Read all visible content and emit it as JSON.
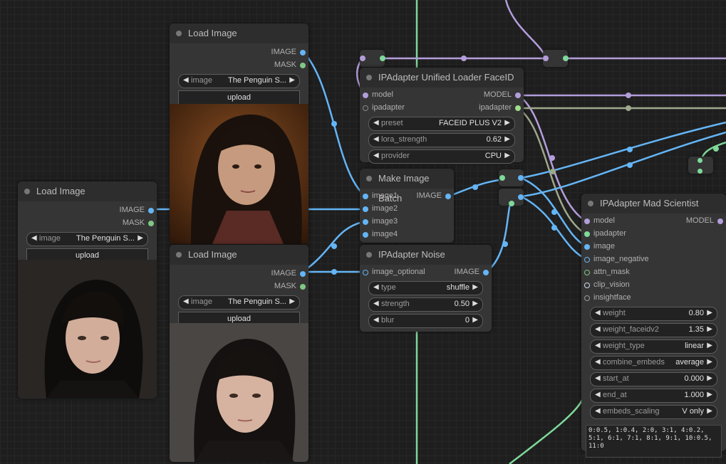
{
  "colors": {
    "image": "#64b5f6",
    "mask": "#81c784",
    "model": "#b39ddb",
    "ipadapter": "#9ea88c",
    "green_wire": "#7fd89a",
    "socket_grey": "#888888"
  },
  "nodes": {
    "load_image_1": {
      "title": "Load Image",
      "out_image": "IMAGE",
      "out_mask": "MASK",
      "widget_label": "image",
      "widget_value": "The Penguin S...",
      "upload_label": "upload"
    },
    "load_image_2": {
      "title": "Load Image",
      "out_image": "IMAGE",
      "out_mask": "MASK",
      "widget_label": "image",
      "widget_value": "The Penguin S...",
      "upload_label": "upload"
    },
    "load_image_3": {
      "title": "Load Image",
      "out_image": "IMAGE",
      "out_mask": "MASK",
      "widget_label": "image",
      "widget_value": "The Penguin S...",
      "upload_label": "upload"
    },
    "unified_loader": {
      "title": "IPAdapter Unified Loader FaceID",
      "in_model": "model",
      "in_ipadapter": "ipadapter",
      "out_model": "MODEL",
      "out_ipadapter": "ipadapter",
      "widgets": [
        {
          "label": "preset",
          "value": "FACEID PLUS V2"
        },
        {
          "label": "lora_strength",
          "value": "0.62"
        },
        {
          "label": "provider",
          "value": "CPU"
        }
      ]
    },
    "make_batch": {
      "title": "Make Image Batch",
      "inputs": [
        "image1",
        "image2",
        "image3",
        "image4"
      ],
      "out_image": "IMAGE"
    },
    "noise": {
      "title": "IPAdapter Noise",
      "in_image_optional": "image_optional",
      "out_image": "IMAGE",
      "widgets": [
        {
          "label": "type",
          "value": "shuffle"
        },
        {
          "label": "strength",
          "value": "0.50"
        },
        {
          "label": "blur",
          "value": "0"
        }
      ]
    },
    "mad_scientist": {
      "title": "IPAdapter Mad Scientist",
      "out_model": "MODEL",
      "inputs": [
        "model",
        "ipadapter",
        "image",
        "image_negative",
        "attn_mask",
        "clip_vision",
        "insightface"
      ],
      "widgets": [
        {
          "label": "weight",
          "value": "0.80"
        },
        {
          "label": "weight_faceidv2",
          "value": "1.35"
        },
        {
          "label": "weight_type",
          "value": "linear"
        },
        {
          "label": "combine_embeds",
          "value": "average"
        },
        {
          "label": "start_at",
          "value": "0.000"
        },
        {
          "label": "end_at",
          "value": "1.000"
        },
        {
          "label": "embeds_scaling",
          "value": "V only"
        }
      ],
      "layer_weights": "0:0.5, 1:0.4, 2:0, 3:1, 4:0.2,\n5:1, 6:1, 7:1, 8:1, 9:1, 10:0.5,\n11:0"
    }
  }
}
